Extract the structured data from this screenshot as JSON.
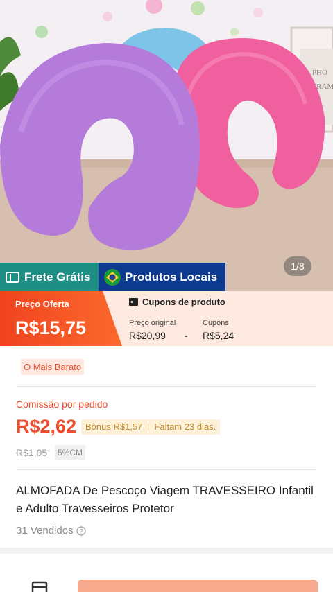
{
  "gallery": {
    "counter": "1/8",
    "alt": "Almofadas de pescoço em formato U (lilás, azul e rosa)"
  },
  "badges": {
    "free_shipping": "Frete Grátis",
    "local_products": "Produtos Locais"
  },
  "price": {
    "offer_label": "Preço Oferta",
    "offer_price": "R$15,75",
    "coupons_title": "Cupons de produto",
    "original_label": "Preço original",
    "original_value": "R$20,99",
    "separator": "-",
    "coupons_label": "Cupons",
    "coupons_value": "R$5,24"
  },
  "details": {
    "cheapest_tag": "O Mais Barato",
    "commission_label": "Comissão por pedido",
    "commission_value": "R$2,62",
    "bonus": "Bônus R$1,57",
    "days_left": "Faltam 23 dias.",
    "old_commission": "R$1,05",
    "rate": "5%CM",
    "title": "ALMOFADA De Pescoço Viagem TRAVESSEIRO Infantil e Adulto Travesseiros Protetor",
    "sold": "31 Vendidos"
  },
  "colors": {
    "accent": "#ee4d2d",
    "frete_badge": "#1f8f86",
    "locais_badge": "#0d3a8c",
    "banner_bg": "#fde9df",
    "bonus_bg": "#fdf1d9"
  },
  "icons": [
    "ticket-icon",
    "brazil-flag-icon",
    "coupon-icon",
    "help-icon",
    "store-icon"
  ]
}
